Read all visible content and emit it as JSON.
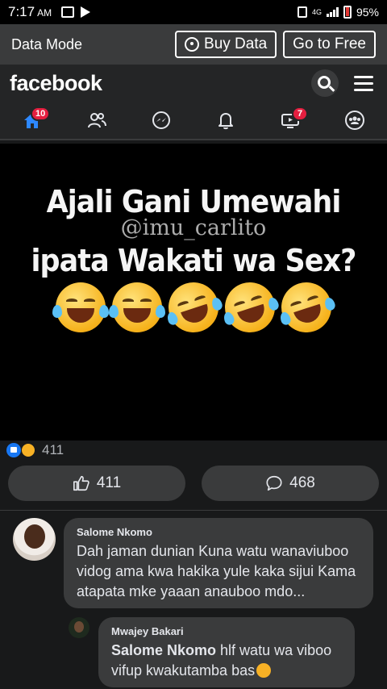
{
  "status_bar": {
    "time": "7:17",
    "ampm": "AM",
    "network": "4G",
    "battery": "95%"
  },
  "data_mode": {
    "label": "Data Mode",
    "buy_data": "Buy Data",
    "go_to_free": "Go to Free"
  },
  "header": {
    "logo": "facebook"
  },
  "nav": {
    "home_badge": "10",
    "watch_badge": "7"
  },
  "post": {
    "image_line1": "Ajali Gani Umewahi",
    "image_watermark": "@imu_carlito",
    "image_line2": "ipata Wakati wa Sex?",
    "reaction_count": "411",
    "like_count": "411",
    "comment_count": "468"
  },
  "comments": [
    {
      "author": "Salome Nkomo",
      "text": "Dah jaman dunian Kuna watu wanaviuboo vidog ama kwa hakika yule kaka sijui Kama atapata mke yaaan anauboo mdo..."
    },
    {
      "author": "Mwajey Bakari",
      "mention": "Salome Nkomo",
      "text": " hlf watu wa viboo vifup kwakutamba bas"
    }
  ],
  "colors": {
    "background": "#18191a",
    "surface": "#242526",
    "bubble": "#3a3b3c",
    "brand_blue": "#1877f2",
    "badge_red": "#e41e3f"
  }
}
